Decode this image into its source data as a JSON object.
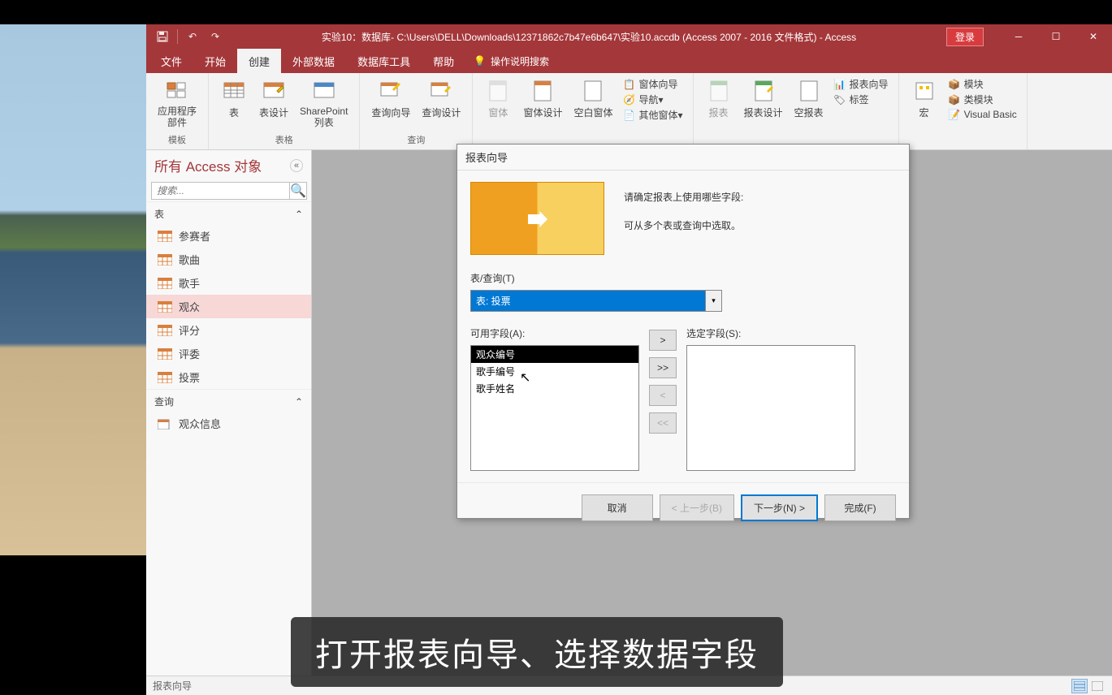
{
  "titlebar": {
    "title": "实验10：数据库- C:\\Users\\DELL\\Downloads\\12371862c7b47e6b647\\实验10.accdb (Access 2007 - 2016 文件格式) - Access",
    "login": "登录"
  },
  "menu": {
    "file": "文件",
    "home": "开始",
    "create": "创建",
    "external": "外部数据",
    "dbtools": "数据库工具",
    "help": "帮助",
    "tellme": "操作说明搜索"
  },
  "ribbon": {
    "app_parts": "应用程序\n部件",
    "table": "表",
    "table_design": "表设计",
    "sharepoint": "SharePoint\n列表",
    "query_wizard": "查询向导",
    "query_design": "查询设计",
    "form": "窗体",
    "form_design": "窗体设计",
    "blank_form": "空白窗体",
    "form_wizard": "窗体向导",
    "navigation": "导航",
    "other_forms": "其他窗体",
    "report": "报表",
    "report_design": "报表设计",
    "blank_report": "空报表",
    "report_wizard": "报表向导",
    "labels": "标签",
    "macro": "宏",
    "module": "模块",
    "class_module": "类模块",
    "visual_basic": "Visual Basic",
    "grp_templates": "模板",
    "grp_tables": "表格",
    "grp_queries": "查询"
  },
  "nav": {
    "title": "所有 Access 对象",
    "search_placeholder": "搜索...",
    "group_tables": "表",
    "group_queries": "查询",
    "tables": [
      "参赛者",
      "歌曲",
      "歌手",
      "观众",
      "评分",
      "评委",
      "投票"
    ],
    "queries": [
      "观众信息"
    ]
  },
  "wizard": {
    "title": "报表向导",
    "instruction1": "请确定报表上使用哪些字段:",
    "instruction2": "可从多个表或查询中选取。",
    "table_query_label": "表/查询(T)",
    "table_query_value": "表: 投票",
    "available_label": "可用字段(A):",
    "selected_label": "选定字段(S):",
    "available_fields": [
      "观众编号",
      "歌手编号",
      "歌手姓名"
    ],
    "btn_add": ">",
    "btn_add_all": ">>",
    "btn_remove": "<",
    "btn_remove_all": "<<",
    "cancel": "取消",
    "back": "< 上一步(B)",
    "next": "下一步(N) >",
    "finish": "完成(F)"
  },
  "statusbar": {
    "text": "报表向导"
  },
  "caption": "打开报表向导、选择数据字段"
}
